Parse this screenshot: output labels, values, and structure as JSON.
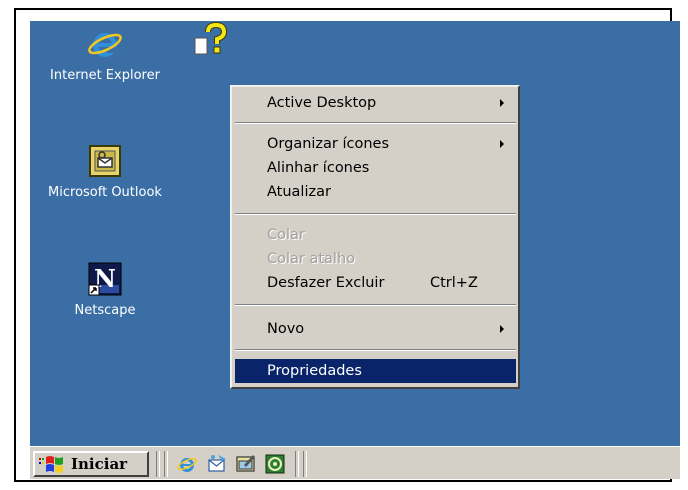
{
  "desktop": {
    "background": "#3a6ea5",
    "icons": [
      {
        "label": "Internet Explorer",
        "icon": "internet-explorer-icon"
      },
      {
        "label": "Microsoft Outlook",
        "icon": "outlook-icon"
      },
      {
        "label": "Netscape",
        "icon": "netscape-shortcut-icon"
      },
      {
        "label": "",
        "icon": "help-file-icon"
      }
    ]
  },
  "context_menu": {
    "items": [
      {
        "label": "Active Desktop",
        "submenu": true,
        "enabled": true
      },
      {
        "label": "Organizar ícones",
        "submenu": true,
        "enabled": true
      },
      {
        "label": "Alinhar ícones",
        "enabled": true
      },
      {
        "label": "Atualizar",
        "enabled": true
      },
      {
        "label": "Colar",
        "enabled": false
      },
      {
        "label": "Colar atalho",
        "enabled": false
      },
      {
        "label": "Desfazer Excluir",
        "shortcut": "Ctrl+Z",
        "enabled": true
      },
      {
        "label": "Novo",
        "submenu": true,
        "enabled": true
      },
      {
        "label": "Propriedades",
        "enabled": true,
        "highlighted": true
      }
    ],
    "highlight_color": "#0a246a"
  },
  "taskbar": {
    "start_label": "Iniciar",
    "quick_launch": [
      "internet-explorer-icon",
      "outlook-express-icon",
      "show-desktop-icon",
      "channels-icon"
    ]
  }
}
